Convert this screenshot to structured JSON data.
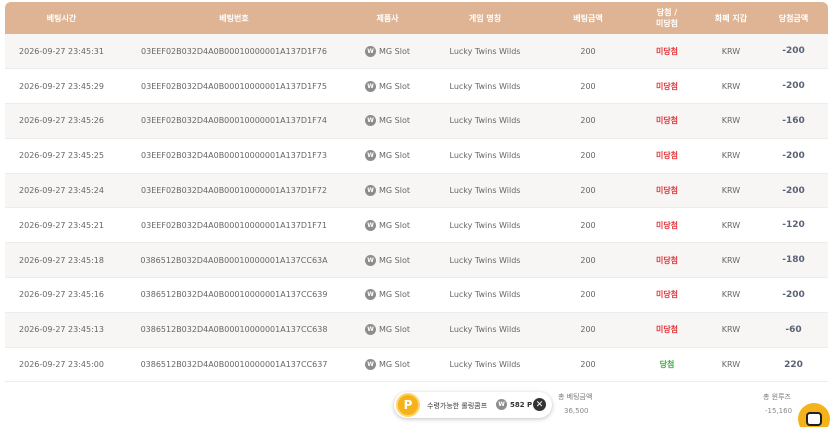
{
  "headers": {
    "time": "베팅시간",
    "bet_id": "베팅번호",
    "provider": "제품사",
    "game": "게임 명칭",
    "amount": "베팅금액",
    "status_line1": "당첨 /",
    "status_line2": "미당첨",
    "currency": "화폐 지갑",
    "win_amount": "당첨금액"
  },
  "rows": [
    {
      "time": "2026-09-27 23:45:31",
      "bet_id": "03EEF02B032D4A0B00010000001A137D1F76",
      "provider": "MG Slot",
      "game": "Lucky Twins Wilds",
      "amount": "200",
      "status": "미당첨",
      "currency": "KRW",
      "win": "-200"
    },
    {
      "time": "2026-09-27 23:45:29",
      "bet_id": "03EEF02B032D4A0B00010000001A137D1F75",
      "provider": "MG Slot",
      "game": "Lucky Twins Wilds",
      "amount": "200",
      "status": "미당첨",
      "currency": "KRW",
      "win": "-200"
    },
    {
      "time": "2026-09-27 23:45:26",
      "bet_id": "03EEF02B032D4A0B00010000001A137D1F74",
      "provider": "MG Slot",
      "game": "Lucky Twins Wilds",
      "amount": "200",
      "status": "미당첨",
      "currency": "KRW",
      "win": "-160"
    },
    {
      "time": "2026-09-27 23:45:25",
      "bet_id": "03EEF02B032D4A0B00010000001A137D1F73",
      "provider": "MG Slot",
      "game": "Lucky Twins Wilds",
      "amount": "200",
      "status": "미당첨",
      "currency": "KRW",
      "win": "-200"
    },
    {
      "time": "2026-09-27 23:45:24",
      "bet_id": "03EEF02B032D4A0B00010000001A137D1F72",
      "provider": "MG Slot",
      "game": "Lucky Twins Wilds",
      "amount": "200",
      "status": "미당첨",
      "currency": "KRW",
      "win": "-200"
    },
    {
      "time": "2026-09-27 23:45:21",
      "bet_id": "03EEF02B032D4A0B00010000001A137D1F71",
      "provider": "MG Slot",
      "game": "Lucky Twins Wilds",
      "amount": "200",
      "status": "미당첨",
      "currency": "KRW",
      "win": "-120"
    },
    {
      "time": "2026-09-27 23:45:18",
      "bet_id": "0386512B032D4A0B00010000001A137CC63A",
      "provider": "MG Slot",
      "game": "Lucky Twins Wilds",
      "amount": "200",
      "status": "미당첨",
      "currency": "KRW",
      "win": "-180"
    },
    {
      "time": "2026-09-27 23:45:16",
      "bet_id": "0386512B032D4A0B00010000001A137CC639",
      "provider": "MG Slot",
      "game": "Lucky Twins Wilds",
      "amount": "200",
      "status": "미당첨",
      "currency": "KRW",
      "win": "-200"
    },
    {
      "time": "2026-09-27 23:45:13",
      "bet_id": "0386512B032D4A0B00010000001A137CC638",
      "provider": "MG Slot",
      "game": "Lucky Twins Wilds",
      "amount": "200",
      "status": "미당첨",
      "currency": "KRW",
      "win": "-60"
    },
    {
      "time": "2026-09-27 23:45:00",
      "bet_id": "0386512B032D4A0B00010000001A137CC637",
      "provider": "MG Slot",
      "game": "Lucky Twins Wilds",
      "amount": "200",
      "status": "당첨",
      "currency": "KRW",
      "win": "220"
    }
  ],
  "provider_logo_letter": "W",
  "totals": {
    "bet_label": "총 베팅금액",
    "bet_value": "36,500",
    "win_label": "총 윈루즈",
    "win_value": "-15,160"
  },
  "jackpot": {
    "coin_letter": "P",
    "label": "수령가능한 롤링콤프",
    "amount": "582 P",
    "icon_letter": "W",
    "close_symbol": "✕"
  },
  "colors": {
    "header_bg": "#deb494",
    "lose": "#e0393e",
    "win": "#35b53a",
    "coin": "#f6b21b"
  }
}
